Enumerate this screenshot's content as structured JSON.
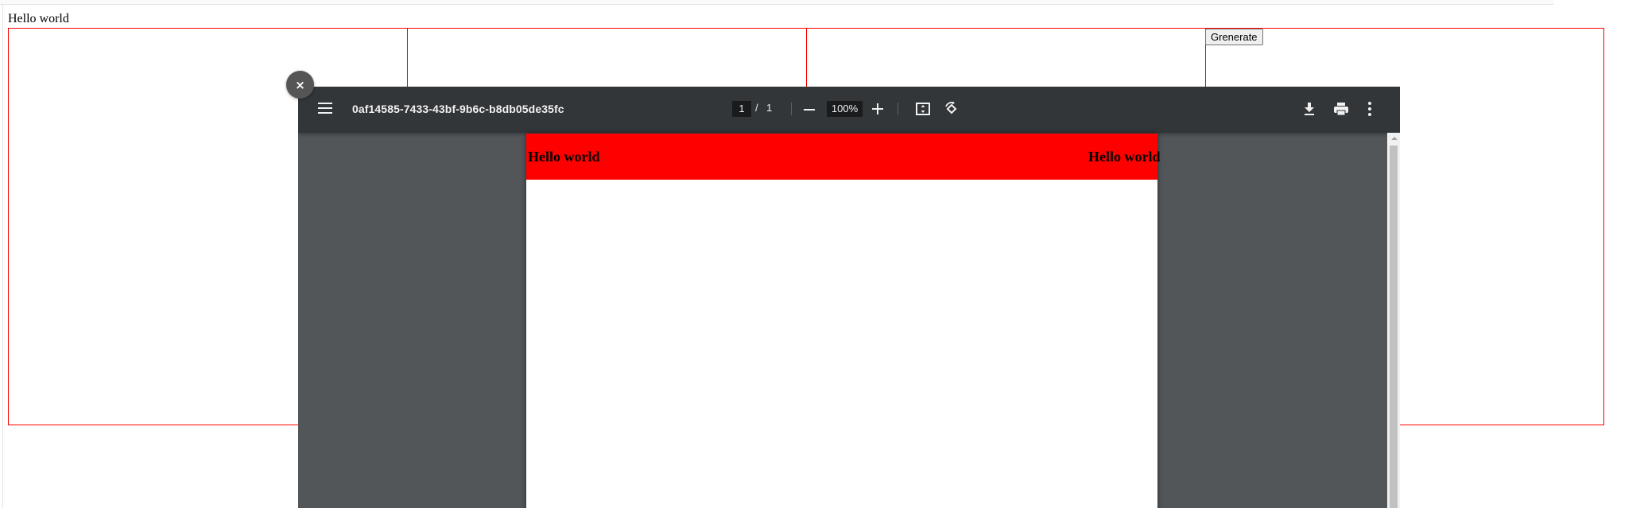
{
  "page": {
    "heading": "Hello world",
    "generate_label": "Grenerate"
  },
  "viewer": {
    "close_symbol": "×",
    "title": "0af14585-7433-43bf-9b6c-b8db05de35fc",
    "page_current": "1",
    "page_separator": "/",
    "page_total": "1",
    "zoom_level": "100%",
    "icons": [
      "menu-icon",
      "zoom-out-icon",
      "zoom-in-icon",
      "fit-to-page-icon",
      "rotate-icon",
      "download-icon",
      "print-icon",
      "more-options-icon",
      "close-icon"
    ],
    "toolbar_color": "#323639",
    "background_color": "#525659"
  },
  "pdf": {
    "header_left": "Hello world",
    "header_right": "Hello world",
    "header_color": "#ff0000"
  },
  "grid": {
    "border_color": "#ff0000",
    "columns": 4
  }
}
